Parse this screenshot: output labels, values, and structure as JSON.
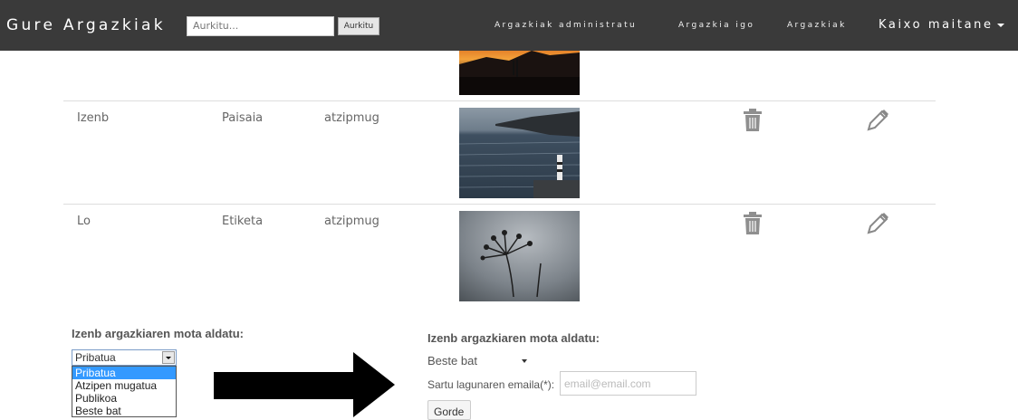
{
  "navbar": {
    "brand": "Gure Argazkiak",
    "search_placeholder": "Aurkitu...",
    "search_button": "Aurkitu",
    "links": [
      "Argazkiak administratu",
      "Argazkia igo",
      "Argazkiak"
    ],
    "user_menu": "Kaixo maitane"
  },
  "table": {
    "rows": [
      {
        "name": "",
        "type": "",
        "permission": "",
        "photo": "sunset"
      },
      {
        "name": "Izenb",
        "type": "Paisaia",
        "permission": "atzipmug",
        "photo": "lighthouse"
      },
      {
        "name": "Lo",
        "type": "Etiketa",
        "permission": "atzipmug",
        "photo": "plant-silhouette"
      }
    ]
  },
  "left_form": {
    "title": "Izenb argazkiaren mota aldatu:",
    "selected": "Pribatua",
    "options": [
      "Pribatua",
      "Atzipen mugatua",
      "Publikoa",
      "Beste bat"
    ],
    "highlighted_option": "Pribatua"
  },
  "right_form": {
    "title": "Izenb argazkiaren mota aldatu:",
    "selected": "Beste bat",
    "email_label": "Sartu lagunaren emaila(*):",
    "email_placeholder": "email@email.com",
    "save_button": "Gorde"
  },
  "colors": {
    "navbar_bg": "#3a3a3a",
    "option_highlight": "#3399ff",
    "row_border": "#dddddd"
  },
  "icons": [
    "trash-icon",
    "pencil-icon",
    "caret-down-icon",
    "right-arrow-annotation"
  ]
}
